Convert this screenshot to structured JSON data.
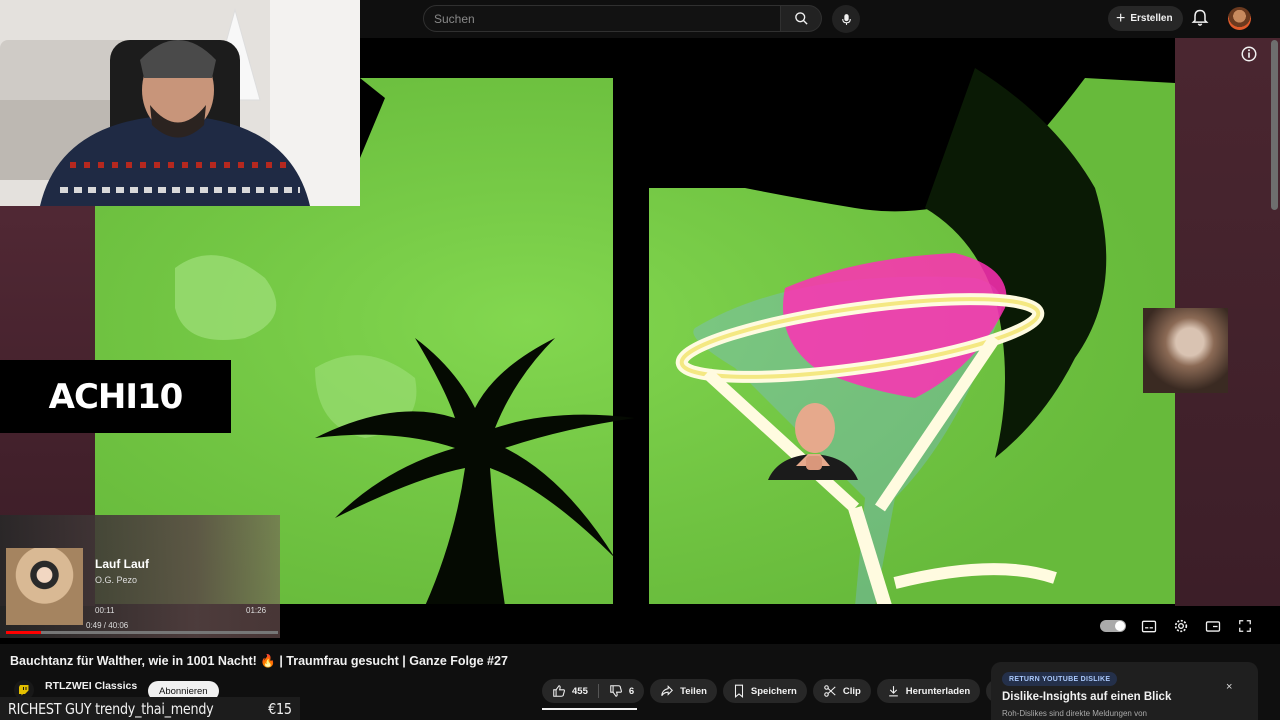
{
  "search": {
    "placeholder": "Suchen"
  },
  "header": {
    "create_label": "Erstellen"
  },
  "logo": {
    "text": "ACHI10"
  },
  "now_playing": {
    "title": "Lauf Lauf",
    "artist": "O.G. Pezo",
    "elapsed": "00:11",
    "duration": "01:26",
    "video_time": "0:49 / 40:06",
    "progress": 0.13
  },
  "video": {
    "title": "Bauchtanz für Walther, wie in 1001 Nacht! 🔥 | Traumfrau gesucht | Ganze Folge #27"
  },
  "channel": {
    "name": "RTLZWEI Classics",
    "subscribe_label": "Abonnieren"
  },
  "actions": {
    "likes": "455",
    "dislikes": "6",
    "share": "Teilen",
    "save": "Speichern",
    "clip": "Clip",
    "download": "Herunterladen"
  },
  "dislike_card": {
    "badge": "RETURN YOUTUBE DISLIKE",
    "title": "Dislike-Insights auf einen Blick",
    "subtitle": "Roh-Dislikes sind direkte Meldungen von",
    "close": "×"
  },
  "donation": {
    "text": "RICHEST GUY trendy_thai_mendy",
    "amount": "€15"
  },
  "colors": {
    "accent": "#ff0000",
    "video_green": "#7ad348",
    "frame": "#4a2630"
  }
}
